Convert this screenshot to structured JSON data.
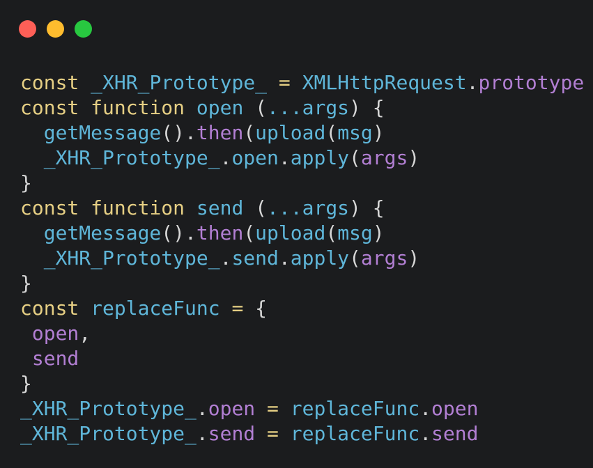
{
  "window_controls": {
    "close_color": "#fe5f57",
    "minimize_color": "#febc2e",
    "maximize_color": "#28c840"
  },
  "colors": {
    "background": "#1b1c1e",
    "keyword": "#e6cf84",
    "identifier": "#5fb6d9",
    "property": "#b27fd3",
    "punctuation": "#d6d6d6"
  },
  "code_lines": [
    [
      {
        "t": "const",
        "c": "kw"
      },
      {
        "t": " ",
        "c": "punc"
      },
      {
        "t": "_XHR_Prototype_",
        "c": "fn"
      },
      {
        "t": " ",
        "c": "punc"
      },
      {
        "t": "=",
        "c": "op"
      },
      {
        "t": " ",
        "c": "punc"
      },
      {
        "t": "XMLHttpRequest",
        "c": "fn"
      },
      {
        "t": ".",
        "c": "punc"
      },
      {
        "t": "prototype",
        "c": "prop"
      }
    ],
    [
      {
        "t": "const",
        "c": "kw"
      },
      {
        "t": " ",
        "c": "punc"
      },
      {
        "t": "function",
        "c": "kw"
      },
      {
        "t": " ",
        "c": "punc"
      },
      {
        "t": "open",
        "c": "fn"
      },
      {
        "t": " (",
        "c": "punc"
      },
      {
        "t": "...args",
        "c": "fn"
      },
      {
        "t": ") {",
        "c": "punc"
      }
    ],
    [
      {
        "t": "  ",
        "c": "punc"
      },
      {
        "t": "getMessage",
        "c": "fn"
      },
      {
        "t": "().",
        "c": "punc"
      },
      {
        "t": "then",
        "c": "prop"
      },
      {
        "t": "(",
        "c": "punc"
      },
      {
        "t": "upload",
        "c": "fn"
      },
      {
        "t": "(",
        "c": "punc"
      },
      {
        "t": "msg",
        "c": "fn"
      },
      {
        "t": ")",
        "c": "punc"
      }
    ],
    [
      {
        "t": "  ",
        "c": "punc"
      },
      {
        "t": "_XHR_Prototype_",
        "c": "fn"
      },
      {
        "t": ".",
        "c": "punc"
      },
      {
        "t": "open",
        "c": "fn"
      },
      {
        "t": ".",
        "c": "punc"
      },
      {
        "t": "apply",
        "c": "fn"
      },
      {
        "t": "(",
        "c": "punc"
      },
      {
        "t": "args",
        "c": "prop"
      },
      {
        "t": ")",
        "c": "punc"
      }
    ],
    [
      {
        "t": "}",
        "c": "punc"
      }
    ],
    [
      {
        "t": "const",
        "c": "kw"
      },
      {
        "t": " ",
        "c": "punc"
      },
      {
        "t": "function",
        "c": "kw"
      },
      {
        "t": " ",
        "c": "punc"
      },
      {
        "t": "send",
        "c": "fn"
      },
      {
        "t": " (",
        "c": "punc"
      },
      {
        "t": "...args",
        "c": "fn"
      },
      {
        "t": ") {",
        "c": "punc"
      }
    ],
    [
      {
        "t": "  ",
        "c": "punc"
      },
      {
        "t": "getMessage",
        "c": "fn"
      },
      {
        "t": "().",
        "c": "punc"
      },
      {
        "t": "then",
        "c": "prop"
      },
      {
        "t": "(",
        "c": "punc"
      },
      {
        "t": "upload",
        "c": "fn"
      },
      {
        "t": "(",
        "c": "punc"
      },
      {
        "t": "msg",
        "c": "fn"
      },
      {
        "t": ")",
        "c": "punc"
      }
    ],
    [
      {
        "t": "  ",
        "c": "punc"
      },
      {
        "t": "_XHR_Prototype_",
        "c": "fn"
      },
      {
        "t": ".",
        "c": "punc"
      },
      {
        "t": "send",
        "c": "fn"
      },
      {
        "t": ".",
        "c": "punc"
      },
      {
        "t": "apply",
        "c": "fn"
      },
      {
        "t": "(",
        "c": "punc"
      },
      {
        "t": "args",
        "c": "prop"
      },
      {
        "t": ")",
        "c": "punc"
      }
    ],
    [
      {
        "t": "}",
        "c": "punc"
      }
    ],
    [
      {
        "t": "const",
        "c": "kw"
      },
      {
        "t": " ",
        "c": "punc"
      },
      {
        "t": "replaceFunc",
        "c": "fn"
      },
      {
        "t": " ",
        "c": "punc"
      },
      {
        "t": "=",
        "c": "op"
      },
      {
        "t": " {",
        "c": "punc"
      }
    ],
    [
      {
        "t": " ",
        "c": "punc"
      },
      {
        "t": "open",
        "c": "prop"
      },
      {
        "t": ",",
        "c": "punc"
      }
    ],
    [
      {
        "t": " ",
        "c": "punc"
      },
      {
        "t": "send",
        "c": "prop"
      }
    ],
    [
      {
        "t": "}",
        "c": "punc"
      }
    ],
    [
      {
        "t": "_XHR_Prototype_",
        "c": "fn"
      },
      {
        "t": ".",
        "c": "punc"
      },
      {
        "t": "open",
        "c": "prop"
      },
      {
        "t": " ",
        "c": "punc"
      },
      {
        "t": "=",
        "c": "op"
      },
      {
        "t": " ",
        "c": "punc"
      },
      {
        "t": "replaceFunc",
        "c": "fn"
      },
      {
        "t": ".",
        "c": "punc"
      },
      {
        "t": "open",
        "c": "prop"
      }
    ],
    [
      {
        "t": "_XHR_Prototype_",
        "c": "fn"
      },
      {
        "t": ".",
        "c": "punc"
      },
      {
        "t": "send",
        "c": "prop"
      },
      {
        "t": " ",
        "c": "punc"
      },
      {
        "t": "=",
        "c": "op"
      },
      {
        "t": " ",
        "c": "punc"
      },
      {
        "t": "replaceFunc",
        "c": "fn"
      },
      {
        "t": ".",
        "c": "punc"
      },
      {
        "t": "send",
        "c": "prop"
      }
    ]
  ]
}
